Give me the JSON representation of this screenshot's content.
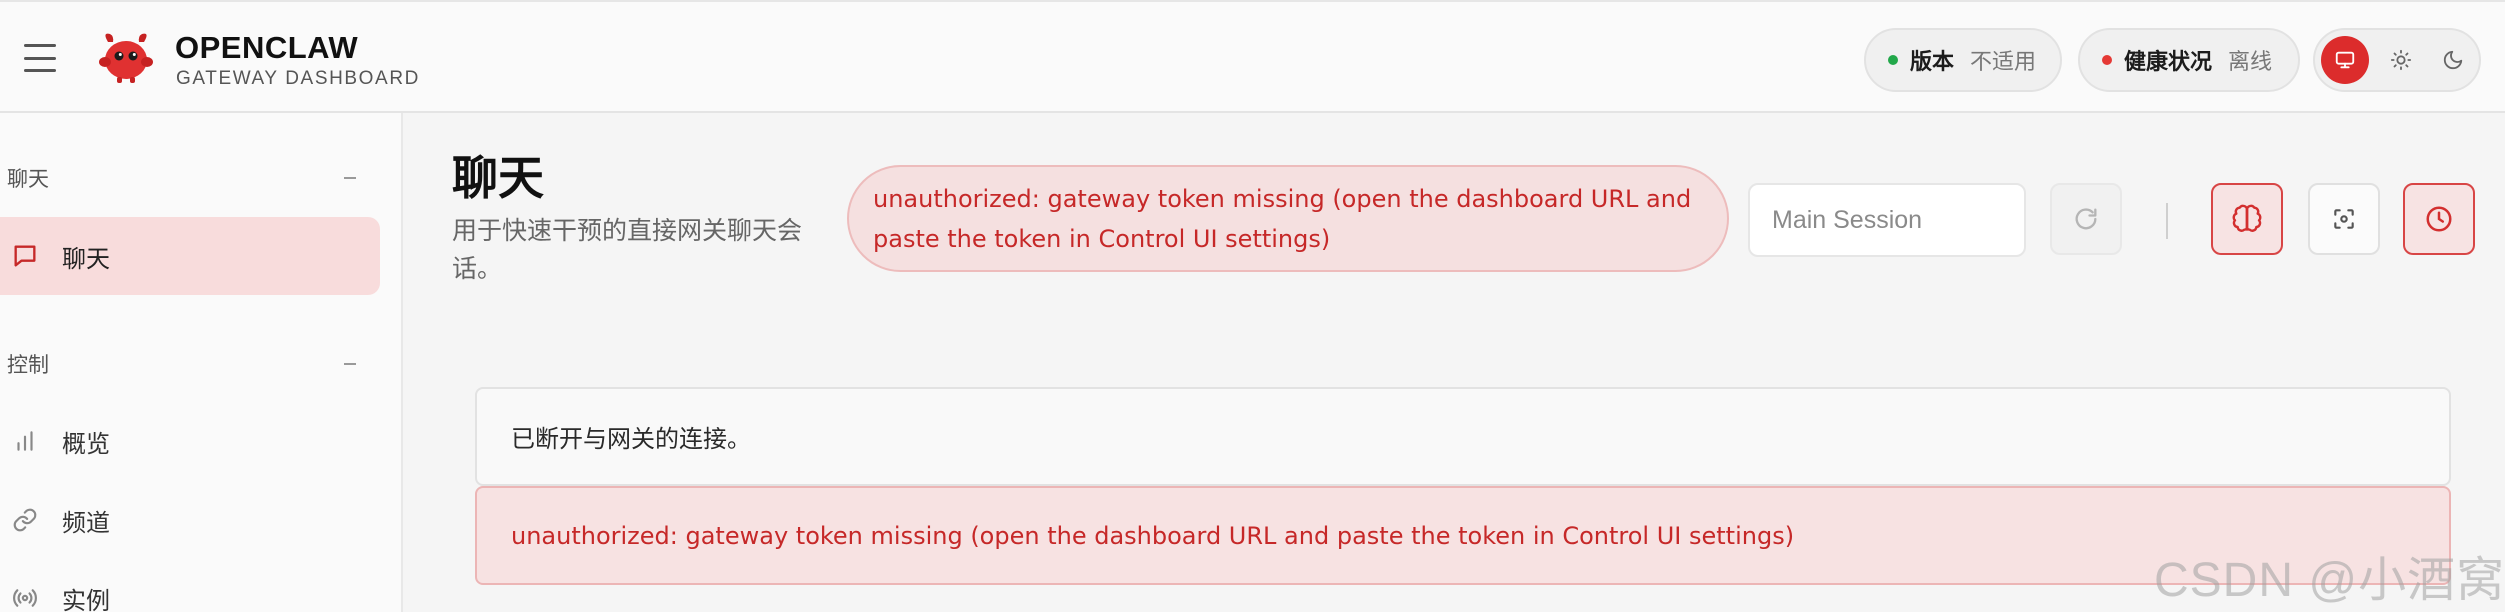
{
  "header": {
    "brand_title": "OPENCLAW",
    "brand_subtitle": "GATEWAY DASHBOARD",
    "version": {
      "label": "版本",
      "value": "不适用",
      "status_color": "#22a84a"
    },
    "health": {
      "label": "健康状况",
      "value": "离线",
      "status_color": "#e53935"
    },
    "theme_modes": [
      "monitor-icon",
      "sun-icon",
      "moon-icon"
    ],
    "active_theme": "monitor-icon"
  },
  "sidebar": {
    "sections": [
      {
        "title": "聊天",
        "items": [
          {
            "label": "聊天",
            "icon": "chat-bubble-icon",
            "active": true
          }
        ]
      },
      {
        "title": "控制",
        "items": [
          {
            "label": "概览",
            "icon": "bar-chart-icon",
            "active": false
          },
          {
            "label": "频道",
            "icon": "link-icon",
            "active": false
          },
          {
            "label": "实例",
            "icon": "broadcast-icon",
            "active": false
          }
        ]
      }
    ]
  },
  "main": {
    "title": "聊天",
    "subtitle": "用于快速干预的直接网关聊天会话。",
    "error_banner": "unauthorized: gateway token missing (open the dashboard URL and paste the token in Control UI settings)",
    "session_placeholder": "Main Session",
    "messages": {
      "info": "已断开与网关的连接。",
      "error": "unauthorized: gateway token missing (open the dashboard URL and paste the token in Control UI settings)"
    }
  },
  "watermark": "CSDN @小酒窝.",
  "colors": {
    "accent": "#dc2c2c",
    "error_text": "#c62828",
    "error_bg": "#f7e2e2",
    "active_nav_bg": "#f8dcdc"
  }
}
